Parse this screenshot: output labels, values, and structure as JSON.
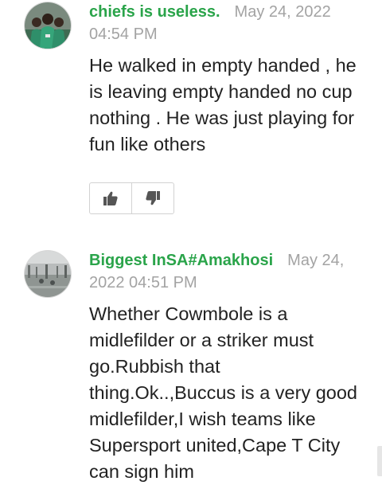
{
  "comments": [
    {
      "author": "chiefs is useless.",
      "date": "May 24, 2022 04:54 PM",
      "text": "He walked in empty handed , he is leaving empty handed no cup nothing . He was just playing for fun like others",
      "avatar_icon": "group-photo-avatar",
      "like_icon": "thumbs-up-icon",
      "dislike_icon": "thumbs-down-icon"
    },
    {
      "author": "Biggest InSA#Amakhosi",
      "date": "May 24, 2022 04:51 PM",
      "text": "Whether Cowmbole is a midlefilder or a striker must go.Rubbish that thing.Ok..,Buccus is a very good midlefilder,I wish teams like Supersport united,Cape T City can sign him",
      "avatar_icon": "stadium-photo-avatar"
    }
  ],
  "colors": {
    "author": "#2aa44a",
    "date": "#a3a3a3",
    "text": "#222222",
    "vote_icon": "#555555"
  }
}
